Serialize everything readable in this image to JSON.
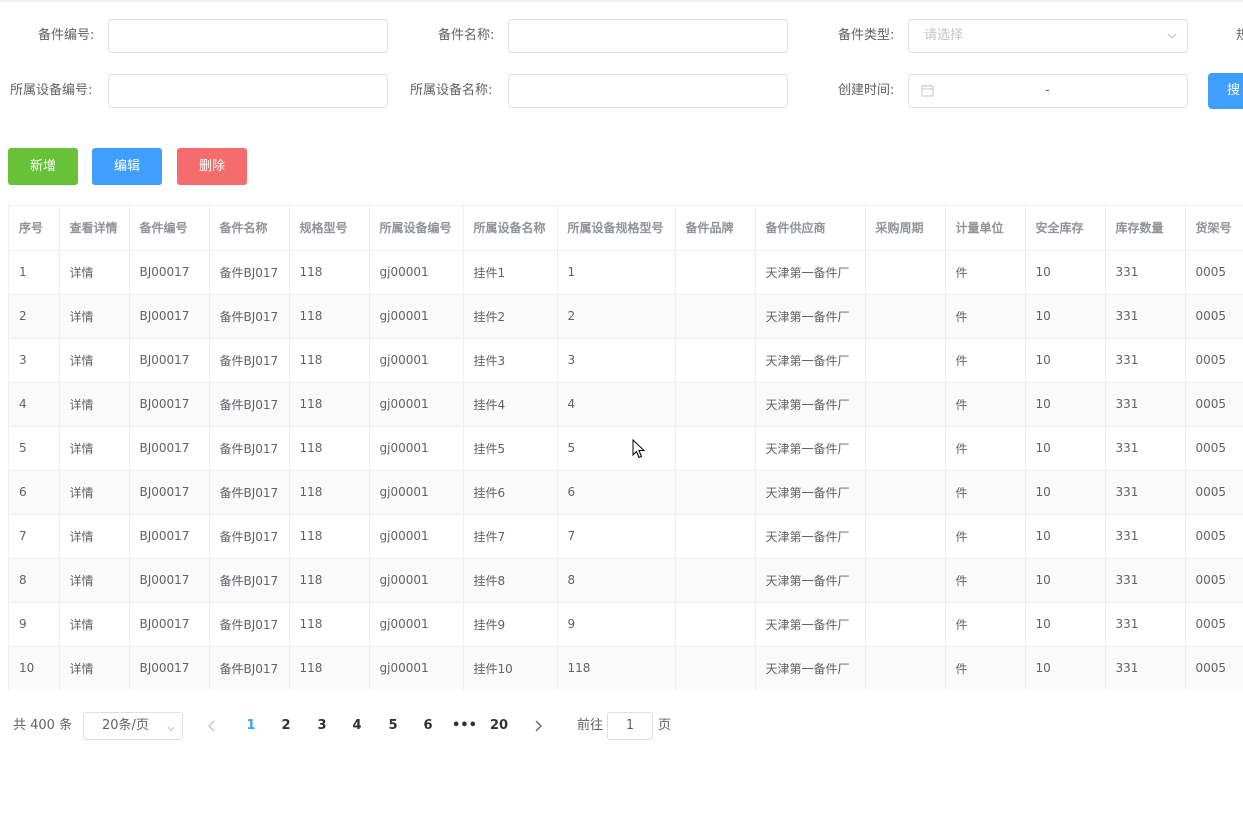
{
  "filters": {
    "part_code_label": "备件编号:",
    "part_name_label": "备件名称:",
    "part_type_label": "备件类型:",
    "part_type_placeholder": "请选择",
    "spec_label_partial": "规",
    "device_code_label": "所属设备编号:",
    "device_name_label": "所属设备名称:",
    "created_time_label": "创建时间:",
    "date_separator": "-",
    "search_label_partial": "搜"
  },
  "toolbar": {
    "add_label": "新增",
    "edit_label": "编辑",
    "delete_label": "删除"
  },
  "colors": {
    "add": "#67c23a",
    "edit": "#409eff",
    "delete": "#f56c6c",
    "active_page": "#409eff"
  },
  "table": {
    "headers": [
      "序号",
      "查看详情",
      "备件编号",
      "备件名称",
      "规格型号",
      "所属设备编号",
      "所属设备名称",
      "所属设备规格型号",
      "备件品牌",
      "备件供应商",
      "采购周期",
      "计量单位",
      "安全库存",
      "库存数量",
      "货架号"
    ],
    "rows": [
      [
        "1",
        "详情",
        "BJ00017",
        "备件BJ017",
        "118",
        "gj00001",
        "挂件1",
        "1",
        "",
        "天津第一备件厂",
        "",
        "件",
        "10",
        "331",
        "0005"
      ],
      [
        "2",
        "详情",
        "BJ00017",
        "备件BJ017",
        "118",
        "gj00001",
        "挂件2",
        "2",
        "",
        "天津第一备件厂",
        "",
        "件",
        "10",
        "331",
        "0005"
      ],
      [
        "3",
        "详情",
        "BJ00017",
        "备件BJ017",
        "118",
        "gj00001",
        "挂件3",
        "3",
        "",
        "天津第一备件厂",
        "",
        "件",
        "10",
        "331",
        "0005"
      ],
      [
        "4",
        "详情",
        "BJ00017",
        "备件BJ017",
        "118",
        "gj00001",
        "挂件4",
        "4",
        "",
        "天津第一备件厂",
        "",
        "件",
        "10",
        "331",
        "0005"
      ],
      [
        "5",
        "详情",
        "BJ00017",
        "备件BJ017",
        "118",
        "gj00001",
        "挂件5",
        "5",
        "",
        "天津第一备件厂",
        "",
        "件",
        "10",
        "331",
        "0005"
      ],
      [
        "6",
        "详情",
        "BJ00017",
        "备件BJ017",
        "118",
        "gj00001",
        "挂件6",
        "6",
        "",
        "天津第一备件厂",
        "",
        "件",
        "10",
        "331",
        "0005"
      ],
      [
        "7",
        "详情",
        "BJ00017",
        "备件BJ017",
        "118",
        "gj00001",
        "挂件7",
        "7",
        "",
        "天津第一备件厂",
        "",
        "件",
        "10",
        "331",
        "0005"
      ],
      [
        "8",
        "详情",
        "BJ00017",
        "备件BJ017",
        "118",
        "gj00001",
        "挂件8",
        "8",
        "",
        "天津第一备件厂",
        "",
        "件",
        "10",
        "331",
        "0005"
      ],
      [
        "9",
        "详情",
        "BJ00017",
        "备件BJ017",
        "118",
        "gj00001",
        "挂件9",
        "9",
        "",
        "天津第一备件厂",
        "",
        "件",
        "10",
        "331",
        "0005"
      ],
      [
        "10",
        "详情",
        "BJ00017",
        "备件BJ017",
        "118",
        "gj00001",
        "挂件10",
        "118",
        "",
        "天津第一备件厂",
        "",
        "件",
        "10",
        "331",
        "0005"
      ]
    ]
  },
  "pagination": {
    "total_text": "共 400 条",
    "page_size": "20条/页",
    "pages": [
      "1",
      "2",
      "3",
      "4",
      "5",
      "6",
      "•••",
      "20"
    ],
    "current_page": "1",
    "goto_label": "前往",
    "goto_value": "1",
    "page_unit": "页"
  },
  "icons": {
    "select_arrow": "chevron-down-icon",
    "date": "calendar-icon",
    "prev": "chevron-left-icon",
    "next": "chevron-right-icon",
    "cursor": "mouse-pointer-icon"
  }
}
